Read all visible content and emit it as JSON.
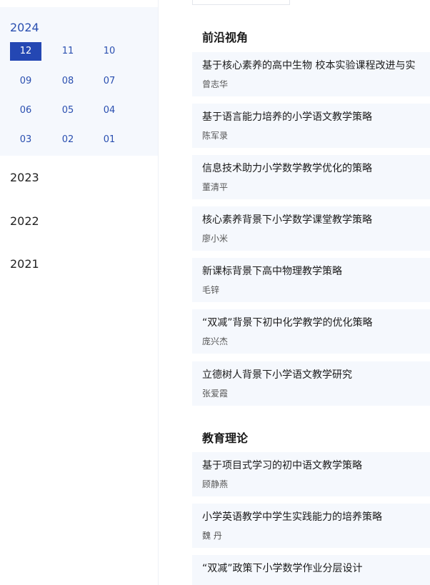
{
  "sidebar": {
    "current_year": "2024",
    "months": [
      "12",
      "11",
      "10",
      "09",
      "08",
      "07",
      "06",
      "05",
      "04",
      "03",
      "02",
      "01"
    ],
    "active_month": "12",
    "other_years": [
      "2023",
      "2022",
      "2021"
    ]
  },
  "sections": [
    {
      "title": "前沿视角",
      "articles": [
        {
          "title": "基于核心素养的高中生物 校本实验课程改进与实",
          "author": "曾志华"
        },
        {
          "title": "基于语言能力培养的小学语文教学策略",
          "author": "陈军录"
        },
        {
          "title": "信息技术助力小学数学教学优化的策略",
          "author": "董清平"
        },
        {
          "title": "核心素养背景下小学数学课堂教学策略",
          "author": "廖小米"
        },
        {
          "title": "新课标背景下高中物理教学策略",
          "author": "毛锌"
        },
        {
          "title": "“双减”背景下初中化学教学的优化策略",
          "author": "庞兴杰"
        },
        {
          "title": "立德树人背景下小学语文教学研究",
          "author": "张爱霞"
        }
      ]
    },
    {
      "title": "教育理论",
      "articles": [
        {
          "title": "基于项目式学习的初中语文教学策略",
          "author": "顾静燕"
        },
        {
          "title": "小学英语教学中学生实践能力的培养策略",
          "author": "魏 丹"
        },
        {
          "title": "“双减”政策下小学数学作业分层设计",
          "author": ""
        }
      ]
    }
  ]
}
